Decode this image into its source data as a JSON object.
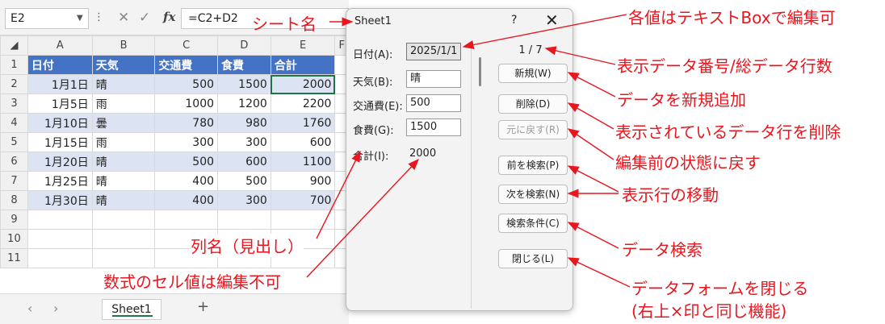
{
  "excel": {
    "name_box": "E2",
    "formula": "=C2+D2",
    "fx_label": "fx",
    "columns": [
      "A",
      "B",
      "C",
      "D",
      "E",
      "F"
    ],
    "rows": [
      "1",
      "2",
      "3",
      "4",
      "5",
      "6",
      "7",
      "8",
      "9",
      "10",
      "11"
    ],
    "headers": [
      "日付",
      "天気",
      "交通費",
      "食費",
      "合計"
    ],
    "data": [
      [
        "1月1日",
        "晴",
        "500",
        "1500",
        "2000"
      ],
      [
        "1月5日",
        "雨",
        "1000",
        "1200",
        "2200"
      ],
      [
        "1月10日",
        "曇",
        "780",
        "980",
        "1760"
      ],
      [
        "1月15日",
        "雨",
        "300",
        "300",
        "600"
      ],
      [
        "1月20日",
        "晴",
        "500",
        "600",
        "1100"
      ],
      [
        "1月25日",
        "晴",
        "400",
        "500",
        "900"
      ],
      [
        "1月30日",
        "晴",
        "400",
        "300",
        "700"
      ]
    ],
    "sheet_tab": "Sheet1",
    "add_sheet": "+",
    "nav_prev": "‹",
    "nav_next": "›"
  },
  "dialog": {
    "title": "Sheet1",
    "help": "?",
    "close": "✕",
    "record_indicator": "1 / 7",
    "fields": {
      "date_label": "日付(A):",
      "date_value": "2025/1/1",
      "weather_label": "天気(B):",
      "weather_value": "晴",
      "transport_label": "交通費(E):",
      "transport_value": "500",
      "food_label": "食費(G):",
      "food_value": "1500",
      "total_label": "合計(I):",
      "total_value": "2000"
    },
    "buttons": {
      "new": "新規(W)",
      "delete": "削除(D)",
      "restore": "元に戻す(R)",
      "find_prev": "前を検索(P)",
      "find_next": "次を検索(N)",
      "criteria": "検索条件(C)",
      "close": "閉じる(L)"
    }
  },
  "annotations": {
    "sheet_name": "シート名",
    "editable": "各値はテキストBoxで編集可",
    "record_number": "表示データ番号/総データ行数",
    "add_new": "データを新規追加",
    "delete_row": "表示されているデータ行を削除",
    "restore": "編集前の状態に戻す",
    "move_row": "表示行の移動",
    "search": "データ検索",
    "close_form": "データフォームを閉じる",
    "close_form_note": "(右上×印と同じ機能)",
    "column_names": "列名（見出し）",
    "formula_cells": "数式のセル値は編集不可"
  },
  "colors": {
    "annotation_red": "#e8161e",
    "table_header_blue": "#4472c4",
    "band_blue": "#dce3f2",
    "excel_green": "#217346"
  }
}
